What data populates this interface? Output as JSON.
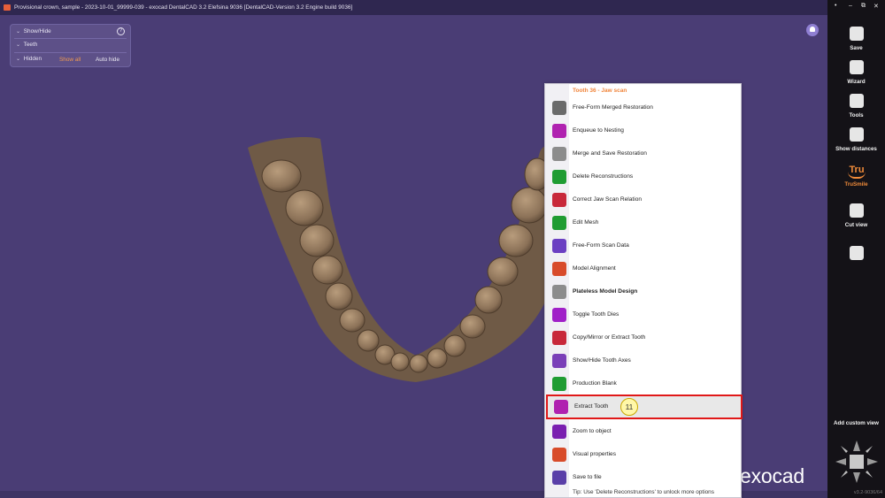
{
  "window": {
    "title": "Provisional crown, sample - 2023-10-01_99999-039 - exocad DentalCAD 3.2 Elefsina 9036 [DentalCAD-Version 3.2 Engine build 9036]",
    "controls": [
      "•",
      "–",
      "⧉",
      "✕"
    ]
  },
  "showhide_panel": {
    "title": "Show/Hide",
    "teeth_label": "Teeth",
    "hidden_label": "Hidden",
    "show_all": "Show all",
    "auto_hide": "Auto hide",
    "help_icon": "?"
  },
  "context_menu": {
    "header": "Tooth 36 - Jaw scan",
    "items": [
      {
        "label": "Free-Form Merged Restoration",
        "icon": "free-form-merged-icon",
        "color": "#6a6a6a"
      },
      {
        "label": "Enqueue to Nesting",
        "icon": "enqueue-nesting-icon",
        "color": "#b022b0"
      },
      {
        "label": "Merge and Save Restoration",
        "icon": "merge-save-icon",
        "color": "#8c8c8c"
      },
      {
        "label": "Delete Reconstructions",
        "icon": "trash-icon",
        "color": "#1f9c32"
      },
      {
        "label": "Correct Jaw Scan Relation",
        "icon": "jaw-relation-icon",
        "color": "#c8283a"
      },
      {
        "label": "Edit Mesh",
        "icon": "edit-mesh-icon",
        "color": "#1f9c32"
      },
      {
        "label": "Free-Form Scan Data",
        "icon": "free-form-scan-icon",
        "color": "#6b3fc2"
      },
      {
        "label": "Model Alignment",
        "icon": "model-alignment-icon",
        "color": "#d84b2a"
      },
      {
        "label": "Plateless Model Design",
        "icon": "plateless-model-icon",
        "color": "#8c8c8c",
        "bold": true
      },
      {
        "label": "Toggle Tooth Dies",
        "icon": "toggle-dies-icon",
        "color": "#a020c8"
      },
      {
        "label": "Copy/Mirror or Extract Tooth",
        "icon": "copy-mirror-icon",
        "color": "#c8283a"
      },
      {
        "label": "Show/Hide Tooth Axes",
        "icon": "tooth-axes-icon",
        "color": "#7a3fb8"
      },
      {
        "label": "Production Blank",
        "icon": "production-blank-icon",
        "color": "#1f9c32"
      },
      {
        "label": "Extract Tooth",
        "icon": "extract-tooth-icon",
        "color": "#b022b0",
        "highlighted": true,
        "step": "11"
      },
      {
        "label": "Zoom to object",
        "icon": "zoom-icon",
        "color": "#7a1fb0"
      },
      {
        "label": "Visual properties",
        "icon": "eye-icon",
        "color": "#d84b2a"
      },
      {
        "label": "Save to file",
        "icon": "save-file-icon",
        "color": "#5a3fa8"
      }
    ],
    "tip": "Tip: Use 'Delete Reconstructions' to unlock more options"
  },
  "brand": "exocad",
  "toolbar": {
    "buttons": [
      {
        "label": "Save",
        "icon": "save-icon"
      },
      {
        "label": "Wizard",
        "icon": "wizard-icon"
      },
      {
        "label": "Tools",
        "icon": "tools-icon"
      },
      {
        "label": "Show distances",
        "icon": "distances-icon"
      },
      {
        "label": "TruSmile",
        "icon": "trusmile-icon",
        "accent": "#f28c3a",
        "glyph": "Tru"
      },
      {
        "label": "Cut view",
        "icon": "cut-view-icon"
      },
      {
        "label": "",
        "icon": "cloud-icon"
      }
    ],
    "add_custom_view": "Add custom view",
    "version": "v3.2-9036/64"
  },
  "colors": {
    "viewport_bg": "#4a3d75",
    "titlebar_bg": "#2f2750",
    "toolbar_bg": "#141217",
    "highlight_border": "#e01818",
    "accent": "#f0843a",
    "tooth_fill": "#9a8064"
  }
}
